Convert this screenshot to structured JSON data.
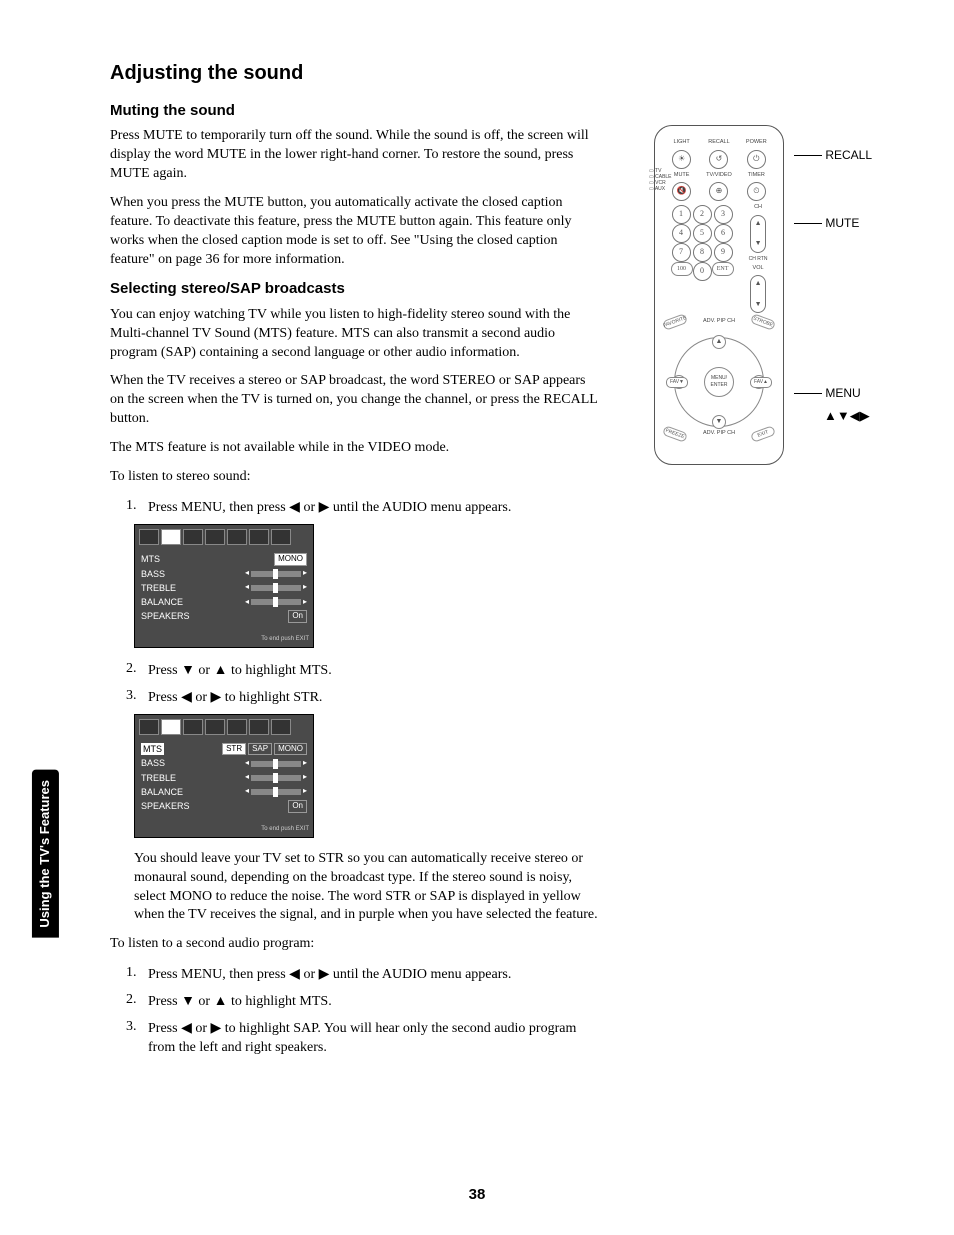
{
  "sideTab": "Using the TV's Features",
  "pageNum": "38",
  "h1": "Adjusting the sound",
  "sec1": {
    "h2": "Muting the sound",
    "p1": "Press MUTE to temporarily turn off the sound. While the sound is off, the screen will display the word MUTE in the lower right-hand corner. To restore the sound, press MUTE again.",
    "p2": "When you press the MUTE button, you automatically activate the closed caption feature. To deactivate this feature, press the MUTE button again. This feature only works when the closed caption mode is set to off. See \"Using the closed caption feature\" on page 36 for more information."
  },
  "sec2": {
    "h2": "Selecting stereo/SAP broadcasts",
    "p1": "You can enjoy watching TV while you listen to high-fidelity stereo sound with the Multi-channel TV Sound (MTS) feature. MTS can also transmit a second audio program (SAP) containing a second language or other audio information.",
    "p2": "When the TV receives a stereo or SAP broadcast, the word STEREO or SAP appears on the screen when the TV is turned on, you change the channel, or press the RECALL button.",
    "p3": "The MTS feature is not available while in the VIDEO mode.",
    "lead1": "To listen to stereo sound:",
    "steps1": {
      "s1a": "Press MENU, then press ",
      "s1b": " or ",
      "s1c": " until the AUDIO menu appears.",
      "s2a": "Press ",
      "s2b": " or ",
      "s2c": " to highlight MTS.",
      "s3a": "Press ",
      "s3b": " or ",
      "s3c": " to highlight STR."
    },
    "note": "You should leave your TV set to STR so you can automatically receive stereo or monaural sound, depending on the broadcast type. If the stereo sound is noisy, select MONO to reduce the noise. The word STR or SAP is displayed in yellow when the TV receives the signal, and in purple when you have selected the feature.",
    "lead2": "To listen to a second audio program:",
    "steps2": {
      "s1a": "Press MENU, then press ",
      "s1b": " or ",
      "s1c": " until the AUDIO menu appears.",
      "s2a": "Press ",
      "s2b": " or ",
      "s2c": " to highlight MTS.",
      "s3a": "Press ",
      "s3b": " or ",
      "s3c": " to highlight SAP. You will hear only the second audio program from the left and right speakers."
    }
  },
  "arrows": {
    "left": "◀",
    "right": "▶",
    "up": "▲",
    "down": "▼",
    "udlr": "▲▼◀▶"
  },
  "osd1": {
    "rows": {
      "mts": "MTS",
      "bass": "BASS",
      "treble": "TREBLE",
      "balance": "BALANCE",
      "speakers": "SPEAKERS"
    },
    "mtsVal": "MONO",
    "spkVal": "On",
    "foot": "To end push EXIT"
  },
  "osd2": {
    "rows": {
      "mts": "MTS",
      "bass": "BASS",
      "treble": "TREBLE",
      "balance": "BALANCE",
      "speakers": "SPEAKERS"
    },
    "opts": {
      "str": "STR",
      "sap": "SAP",
      "mono": "MONO"
    },
    "spkVal": "On",
    "foot": "To end push EXIT"
  },
  "remote": {
    "labels": {
      "recall": "RECALL",
      "mute": "MUTE",
      "menu": "MENU"
    },
    "top": {
      "light": "LIGHT",
      "recall": "RECALL",
      "power": "POWER",
      "mute": "MUTE",
      "tvvideo": "TV/VIDEO",
      "timer": "TIMER"
    },
    "side": {
      "tv": "TV",
      "cable": "CABLE",
      "vcr": "VCR",
      "aux": "AUX"
    },
    "rockers": {
      "ch": "CH",
      "chrtn": "CH RTN",
      "vol": "VOL"
    },
    "num": {
      "1": "1",
      "2": "2",
      "3": "3",
      "4": "4",
      "5": "5",
      "6": "6",
      "7": "7",
      "8": "8",
      "9": "9",
      "100": "100",
      "0": "0",
      "ent": "ENT"
    },
    "diag": {
      "fav": "FAVORITE",
      "strobe": "STROBE",
      "freeze": "FREEZE",
      "exit": "EXIT"
    },
    "adv": "ADV. PIP CH",
    "center": "MENU/ ENTER",
    "favL": "FAV▼",
    "favR": "FAV▲"
  }
}
